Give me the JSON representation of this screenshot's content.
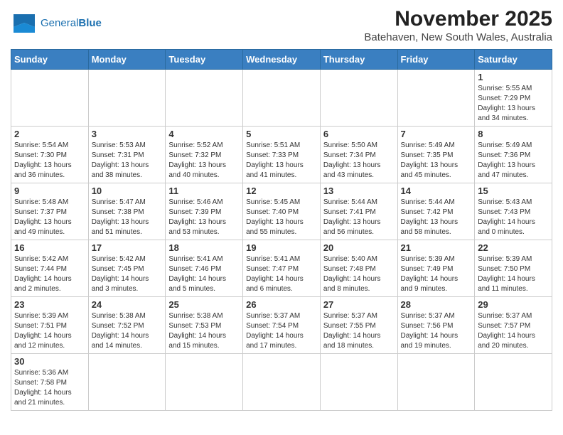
{
  "header": {
    "logo_general": "General",
    "logo_blue": "Blue",
    "month_title": "November 2025",
    "location": "Batehaven, New South Wales, Australia"
  },
  "weekdays": [
    "Sunday",
    "Monday",
    "Tuesday",
    "Wednesday",
    "Thursday",
    "Friday",
    "Saturday"
  ],
  "weeks": [
    [
      {
        "day": "",
        "content": ""
      },
      {
        "day": "",
        "content": ""
      },
      {
        "day": "",
        "content": ""
      },
      {
        "day": "",
        "content": ""
      },
      {
        "day": "",
        "content": ""
      },
      {
        "day": "",
        "content": ""
      },
      {
        "day": "1",
        "content": "Sunrise: 5:55 AM\nSunset: 7:29 PM\nDaylight: 13 hours\nand 34 minutes."
      }
    ],
    [
      {
        "day": "2",
        "content": "Sunrise: 5:54 AM\nSunset: 7:30 PM\nDaylight: 13 hours\nand 36 minutes."
      },
      {
        "day": "3",
        "content": "Sunrise: 5:53 AM\nSunset: 7:31 PM\nDaylight: 13 hours\nand 38 minutes."
      },
      {
        "day": "4",
        "content": "Sunrise: 5:52 AM\nSunset: 7:32 PM\nDaylight: 13 hours\nand 40 minutes."
      },
      {
        "day": "5",
        "content": "Sunrise: 5:51 AM\nSunset: 7:33 PM\nDaylight: 13 hours\nand 41 minutes."
      },
      {
        "day": "6",
        "content": "Sunrise: 5:50 AM\nSunset: 7:34 PM\nDaylight: 13 hours\nand 43 minutes."
      },
      {
        "day": "7",
        "content": "Sunrise: 5:49 AM\nSunset: 7:35 PM\nDaylight: 13 hours\nand 45 minutes."
      },
      {
        "day": "8",
        "content": "Sunrise: 5:49 AM\nSunset: 7:36 PM\nDaylight: 13 hours\nand 47 minutes."
      }
    ],
    [
      {
        "day": "9",
        "content": "Sunrise: 5:48 AM\nSunset: 7:37 PM\nDaylight: 13 hours\nand 49 minutes."
      },
      {
        "day": "10",
        "content": "Sunrise: 5:47 AM\nSunset: 7:38 PM\nDaylight: 13 hours\nand 51 minutes."
      },
      {
        "day": "11",
        "content": "Sunrise: 5:46 AM\nSunset: 7:39 PM\nDaylight: 13 hours\nand 53 minutes."
      },
      {
        "day": "12",
        "content": "Sunrise: 5:45 AM\nSunset: 7:40 PM\nDaylight: 13 hours\nand 55 minutes."
      },
      {
        "day": "13",
        "content": "Sunrise: 5:44 AM\nSunset: 7:41 PM\nDaylight: 13 hours\nand 56 minutes."
      },
      {
        "day": "14",
        "content": "Sunrise: 5:44 AM\nSunset: 7:42 PM\nDaylight: 13 hours\nand 58 minutes."
      },
      {
        "day": "15",
        "content": "Sunrise: 5:43 AM\nSunset: 7:43 PM\nDaylight: 14 hours\nand 0 minutes."
      }
    ],
    [
      {
        "day": "16",
        "content": "Sunrise: 5:42 AM\nSunset: 7:44 PM\nDaylight: 14 hours\nand 2 minutes."
      },
      {
        "day": "17",
        "content": "Sunrise: 5:42 AM\nSunset: 7:45 PM\nDaylight: 14 hours\nand 3 minutes."
      },
      {
        "day": "18",
        "content": "Sunrise: 5:41 AM\nSunset: 7:46 PM\nDaylight: 14 hours\nand 5 minutes."
      },
      {
        "day": "19",
        "content": "Sunrise: 5:41 AM\nSunset: 7:47 PM\nDaylight: 14 hours\nand 6 minutes."
      },
      {
        "day": "20",
        "content": "Sunrise: 5:40 AM\nSunset: 7:48 PM\nDaylight: 14 hours\nand 8 minutes."
      },
      {
        "day": "21",
        "content": "Sunrise: 5:39 AM\nSunset: 7:49 PM\nDaylight: 14 hours\nand 9 minutes."
      },
      {
        "day": "22",
        "content": "Sunrise: 5:39 AM\nSunset: 7:50 PM\nDaylight: 14 hours\nand 11 minutes."
      }
    ],
    [
      {
        "day": "23",
        "content": "Sunrise: 5:39 AM\nSunset: 7:51 PM\nDaylight: 14 hours\nand 12 minutes."
      },
      {
        "day": "24",
        "content": "Sunrise: 5:38 AM\nSunset: 7:52 PM\nDaylight: 14 hours\nand 14 minutes."
      },
      {
        "day": "25",
        "content": "Sunrise: 5:38 AM\nSunset: 7:53 PM\nDaylight: 14 hours\nand 15 minutes."
      },
      {
        "day": "26",
        "content": "Sunrise: 5:37 AM\nSunset: 7:54 PM\nDaylight: 14 hours\nand 17 minutes."
      },
      {
        "day": "27",
        "content": "Sunrise: 5:37 AM\nSunset: 7:55 PM\nDaylight: 14 hours\nand 18 minutes."
      },
      {
        "day": "28",
        "content": "Sunrise: 5:37 AM\nSunset: 7:56 PM\nDaylight: 14 hours\nand 19 minutes."
      },
      {
        "day": "29",
        "content": "Sunrise: 5:37 AM\nSunset: 7:57 PM\nDaylight: 14 hours\nand 20 minutes."
      }
    ],
    [
      {
        "day": "30",
        "content": "Sunrise: 5:36 AM\nSunset: 7:58 PM\nDaylight: 14 hours\nand 21 minutes."
      },
      {
        "day": "",
        "content": ""
      },
      {
        "day": "",
        "content": ""
      },
      {
        "day": "",
        "content": ""
      },
      {
        "day": "",
        "content": ""
      },
      {
        "day": "",
        "content": ""
      },
      {
        "day": "",
        "content": ""
      }
    ]
  ]
}
